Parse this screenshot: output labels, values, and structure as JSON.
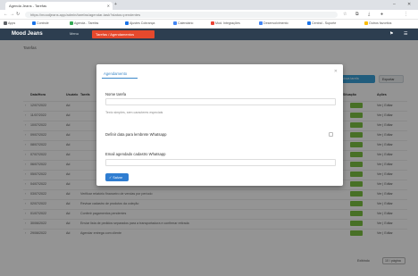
{
  "browser": {
    "tab_title": "Agenda Jeans - Tarefas",
    "url": "https://moodjeans.app/admin/tarefas/agendar-task?status=pendentes",
    "bookmarks": [
      {
        "label": "Apps",
        "color": "#5f6368"
      },
      {
        "label": "Controle",
        "color": "#1a73e8"
      },
      {
        "label": "Agenda - Tarefas",
        "color": "#34a853"
      },
      {
        "label": "Ajustes Cobrança",
        "color": "#1a73e8"
      },
      {
        "label": "Calendário",
        "color": "#4285f4"
      },
      {
        "label": "Mod. Integrações",
        "color": "#ea4335"
      },
      {
        "label": "Desenvolvimento",
        "color": "#4285f4"
      },
      {
        "label": "Central - Suporte",
        "color": "#1a73e8"
      },
      {
        "label": "Outros favoritos",
        "color": "#fbbc04"
      }
    ]
  },
  "app": {
    "title": "Mood Jeans",
    "nav1": "Menu",
    "nav2": "Tarefas / Agendamentos"
  },
  "page": {
    "heading": "Tarefas",
    "new_task_label": "Nova tarefa",
    "export_label": "Exportar",
    "columns": {
      "date": "Data/Hora",
      "user": "Usuário",
      "task": "Tarefa",
      "status": "Situação",
      "actions": "Ações"
    },
    "rows": [
      {
        "date": "12/07/2022",
        "user": "Ad",
        "task": "",
        "status": "",
        "action": "Ver | Editar"
      },
      {
        "date": "11/07/2022",
        "user": "Ad",
        "task": "",
        "status": "",
        "action": "Ver | Editar"
      },
      {
        "date": "10/07/2022",
        "user": "Ad",
        "task": "",
        "status": "",
        "action": "Ver | Editar"
      },
      {
        "date": "09/07/2022",
        "user": "Ad",
        "task": "",
        "status": "",
        "action": "Ver | Editar"
      },
      {
        "date": "08/07/2022",
        "user": "Ad",
        "task": "",
        "status": "",
        "action": "Ver | Editar"
      },
      {
        "date": "07/07/2022",
        "user": "Ad",
        "task": "",
        "status": "",
        "action": "Ver | Editar"
      },
      {
        "date": "06/07/2022",
        "user": "Ad",
        "task": "",
        "status": "",
        "action": "Ver | Editar"
      },
      {
        "date": "05/07/2022",
        "user": "Ad",
        "task": "",
        "status": "",
        "action": "Ver | Editar"
      },
      {
        "date": "04/07/2022",
        "user": "Ad",
        "task": "",
        "status": "",
        "action": "Ver | Editar"
      },
      {
        "date": "03/07/2022",
        "user": "Ad",
        "task": "Verificar relatório financeiro de vendas por período",
        "status": "Ativo",
        "action": "Ver | Editar"
      },
      {
        "date": "02/07/2022",
        "user": "Ad",
        "task": "Revisar cadastro de produtos da coleção",
        "status": "Ativo",
        "action": "Ver | Editar"
      },
      {
        "date": "01/07/2022",
        "user": "Ad",
        "task": "Conferir pagamentos pendentes",
        "status": "Ativo",
        "action": "Ver | Editar"
      },
      {
        "date": "30/06/2022",
        "user": "Ad",
        "task": "Enviar lista de pedidos separados para a transportadora e confirmar retirada",
        "status": "Ativo",
        "action": "Ver | Editar"
      },
      {
        "date": "29/06/2022",
        "user": "Ad",
        "task": "Agendar entrega com cliente",
        "status": "Ativo",
        "action": "Ver | Editar"
      }
    ],
    "pager_text": "Exibindo",
    "pager_box": "10 / página"
  },
  "dialog": {
    "tab_label": "Agendamento",
    "field1_label": "Nome tarefa",
    "field1_value": "",
    "field1_hint": "Texto simples, sem caracteres especiais",
    "field2_label": "Definir data para lembrete Whatsapp",
    "field3_label": "Email agendado cadastro Whatsapp",
    "field3_value": "",
    "save_label": "Salvar"
  }
}
